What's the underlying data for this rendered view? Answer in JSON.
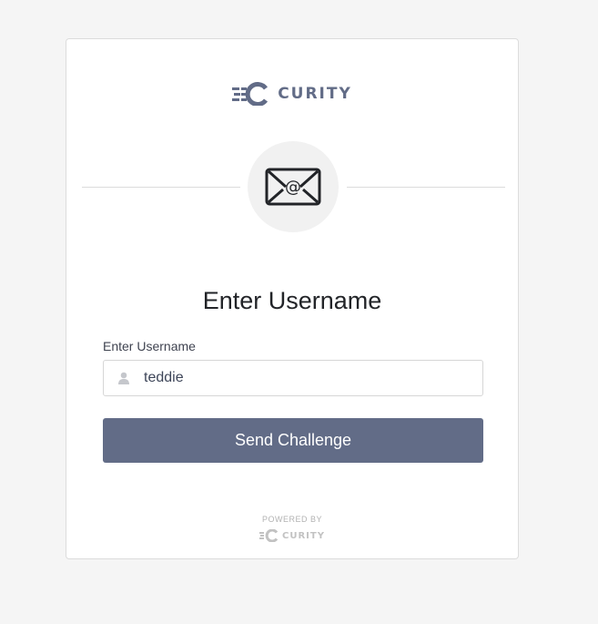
{
  "brand": {
    "name": "CURITY",
    "color": "#626c87"
  },
  "authenticator": {
    "icon": "email-at-icon"
  },
  "form": {
    "heading": "Enter Username",
    "username_label": "Enter Username",
    "username_value": "teddie",
    "user_icon": "user-icon",
    "submit_label": "Send Challenge"
  },
  "footer": {
    "powered_by": "POWERED BY",
    "brand": "CURITY"
  }
}
